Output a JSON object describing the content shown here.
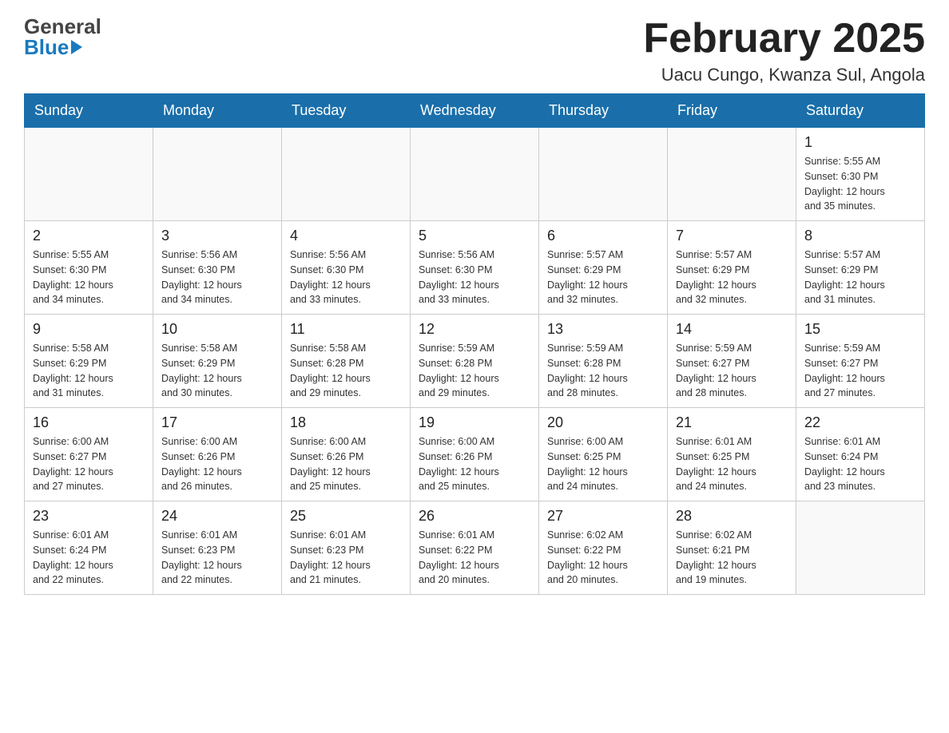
{
  "header": {
    "logo_line1": "General",
    "logo_line2": "Blue",
    "title": "February 2025",
    "subtitle": "Uacu Cungo, Kwanza Sul, Angola"
  },
  "weekdays": [
    "Sunday",
    "Monday",
    "Tuesday",
    "Wednesday",
    "Thursday",
    "Friday",
    "Saturday"
  ],
  "weeks": [
    [
      {
        "day": "",
        "info": ""
      },
      {
        "day": "",
        "info": ""
      },
      {
        "day": "",
        "info": ""
      },
      {
        "day": "",
        "info": ""
      },
      {
        "day": "",
        "info": ""
      },
      {
        "day": "",
        "info": ""
      },
      {
        "day": "1",
        "info": "Sunrise: 5:55 AM\nSunset: 6:30 PM\nDaylight: 12 hours\nand 35 minutes."
      }
    ],
    [
      {
        "day": "2",
        "info": "Sunrise: 5:55 AM\nSunset: 6:30 PM\nDaylight: 12 hours\nand 34 minutes."
      },
      {
        "day": "3",
        "info": "Sunrise: 5:56 AM\nSunset: 6:30 PM\nDaylight: 12 hours\nand 34 minutes."
      },
      {
        "day": "4",
        "info": "Sunrise: 5:56 AM\nSunset: 6:30 PM\nDaylight: 12 hours\nand 33 minutes."
      },
      {
        "day": "5",
        "info": "Sunrise: 5:56 AM\nSunset: 6:30 PM\nDaylight: 12 hours\nand 33 minutes."
      },
      {
        "day": "6",
        "info": "Sunrise: 5:57 AM\nSunset: 6:29 PM\nDaylight: 12 hours\nand 32 minutes."
      },
      {
        "day": "7",
        "info": "Sunrise: 5:57 AM\nSunset: 6:29 PM\nDaylight: 12 hours\nand 32 minutes."
      },
      {
        "day": "8",
        "info": "Sunrise: 5:57 AM\nSunset: 6:29 PM\nDaylight: 12 hours\nand 31 minutes."
      }
    ],
    [
      {
        "day": "9",
        "info": "Sunrise: 5:58 AM\nSunset: 6:29 PM\nDaylight: 12 hours\nand 31 minutes."
      },
      {
        "day": "10",
        "info": "Sunrise: 5:58 AM\nSunset: 6:29 PM\nDaylight: 12 hours\nand 30 minutes."
      },
      {
        "day": "11",
        "info": "Sunrise: 5:58 AM\nSunset: 6:28 PM\nDaylight: 12 hours\nand 29 minutes."
      },
      {
        "day": "12",
        "info": "Sunrise: 5:59 AM\nSunset: 6:28 PM\nDaylight: 12 hours\nand 29 minutes."
      },
      {
        "day": "13",
        "info": "Sunrise: 5:59 AM\nSunset: 6:28 PM\nDaylight: 12 hours\nand 28 minutes."
      },
      {
        "day": "14",
        "info": "Sunrise: 5:59 AM\nSunset: 6:27 PM\nDaylight: 12 hours\nand 28 minutes."
      },
      {
        "day": "15",
        "info": "Sunrise: 5:59 AM\nSunset: 6:27 PM\nDaylight: 12 hours\nand 27 minutes."
      }
    ],
    [
      {
        "day": "16",
        "info": "Sunrise: 6:00 AM\nSunset: 6:27 PM\nDaylight: 12 hours\nand 27 minutes."
      },
      {
        "day": "17",
        "info": "Sunrise: 6:00 AM\nSunset: 6:26 PM\nDaylight: 12 hours\nand 26 minutes."
      },
      {
        "day": "18",
        "info": "Sunrise: 6:00 AM\nSunset: 6:26 PM\nDaylight: 12 hours\nand 25 minutes."
      },
      {
        "day": "19",
        "info": "Sunrise: 6:00 AM\nSunset: 6:26 PM\nDaylight: 12 hours\nand 25 minutes."
      },
      {
        "day": "20",
        "info": "Sunrise: 6:00 AM\nSunset: 6:25 PM\nDaylight: 12 hours\nand 24 minutes."
      },
      {
        "day": "21",
        "info": "Sunrise: 6:01 AM\nSunset: 6:25 PM\nDaylight: 12 hours\nand 24 minutes."
      },
      {
        "day": "22",
        "info": "Sunrise: 6:01 AM\nSunset: 6:24 PM\nDaylight: 12 hours\nand 23 minutes."
      }
    ],
    [
      {
        "day": "23",
        "info": "Sunrise: 6:01 AM\nSunset: 6:24 PM\nDaylight: 12 hours\nand 22 minutes."
      },
      {
        "day": "24",
        "info": "Sunrise: 6:01 AM\nSunset: 6:23 PM\nDaylight: 12 hours\nand 22 minutes."
      },
      {
        "day": "25",
        "info": "Sunrise: 6:01 AM\nSunset: 6:23 PM\nDaylight: 12 hours\nand 21 minutes."
      },
      {
        "day": "26",
        "info": "Sunrise: 6:01 AM\nSunset: 6:22 PM\nDaylight: 12 hours\nand 20 minutes."
      },
      {
        "day": "27",
        "info": "Sunrise: 6:02 AM\nSunset: 6:22 PM\nDaylight: 12 hours\nand 20 minutes."
      },
      {
        "day": "28",
        "info": "Sunrise: 6:02 AM\nSunset: 6:21 PM\nDaylight: 12 hours\nand 19 minutes."
      },
      {
        "day": "",
        "info": ""
      }
    ]
  ]
}
